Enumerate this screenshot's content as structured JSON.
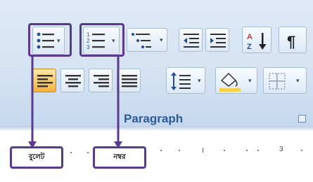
{
  "ribbon": {
    "group_label": "Paragraph",
    "row1": [
      {
        "name": "bullets-button",
        "icon": "bullet-list-icon",
        "dropdown": true
      },
      {
        "name": "numbering-button",
        "icon": "numbered-list-icon",
        "dropdown": true
      },
      {
        "name": "multilevel-list-button",
        "icon": "multilevel-list-icon",
        "dropdown": true
      },
      {
        "name": "decrease-indent-button",
        "icon": "decrease-indent-icon"
      },
      {
        "name": "increase-indent-button",
        "icon": "increase-indent-icon"
      },
      {
        "name": "sort-button",
        "icon": "sort-az-icon",
        "text": "A↓Z"
      },
      {
        "name": "show-hide-button",
        "icon": "pilcrow-icon",
        "text": "¶"
      }
    ],
    "row2": [
      {
        "name": "align-left-button",
        "icon": "align-left-icon",
        "selected": true
      },
      {
        "name": "center-button",
        "icon": "align-center-icon"
      },
      {
        "name": "align-right-button",
        "icon": "align-right-icon"
      },
      {
        "name": "justify-button",
        "icon": "justify-icon"
      },
      {
        "name": "line-spacing-button",
        "icon": "line-spacing-icon",
        "dropdown": true
      },
      {
        "name": "shading-button",
        "icon": "paint-bucket-icon",
        "dropdown": true
      },
      {
        "name": "borders-button",
        "icon": "borders-icon",
        "dropdown": true
      }
    ],
    "dropdown_glyph": "▾"
  },
  "ruler": {
    "numbers": [
      "1",
      "2",
      "3"
    ]
  },
  "callouts": {
    "bullets": "বুলেট",
    "numbering": "নম্বর"
  },
  "colors": {
    "annotation": "#5a3a8e",
    "ribbon": "#d5e3f3",
    "group_label": "#2d5a96",
    "icon_blue": "#1f4e9c",
    "selected": "#f3b33d"
  }
}
